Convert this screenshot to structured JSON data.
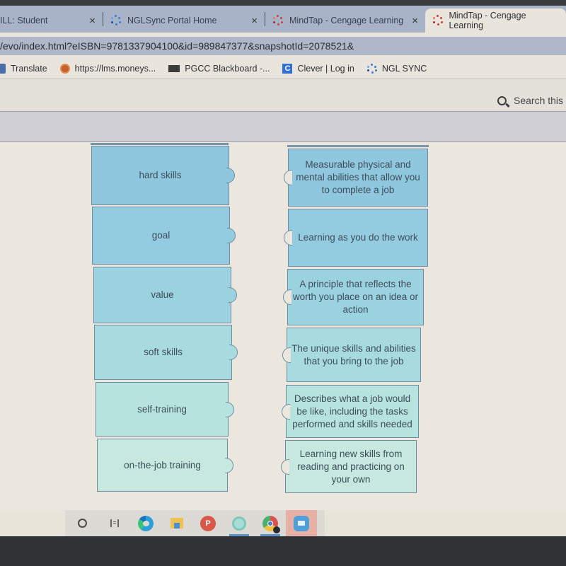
{
  "browser": {
    "tabs": [
      {
        "title": "ILL: Student",
        "icon": "page-icon",
        "active": false
      },
      {
        "title": "NGLSync Portal Home",
        "icon": "ngl-sync-icon",
        "active": false
      },
      {
        "title": "MindTap - Cengage Learning",
        "icon": "mindtap-icon",
        "active": false
      },
      {
        "title": "MindTap - Cengage Learning",
        "icon": "mindtap-icon",
        "active": true
      }
    ],
    "tab_close_glyph": "×",
    "url": "/evo/index.html?eISBN=9781337904100&id=989847377&snapshotId=2078521&",
    "bookmarks": [
      {
        "label": "Translate",
        "icon": "translate-icon"
      },
      {
        "label": "https://lms.moneys...",
        "icon": "moneyskill-icon"
      },
      {
        "label": "PGCC Blackboard -...",
        "icon": "blackboard-icon"
      },
      {
        "label": "Clever | Log in",
        "icon": "clever-icon"
      },
      {
        "label": "NGL SYNC",
        "icon": "ngl-sync-icon"
      }
    ]
  },
  "app": {
    "search_label": "Search this"
  },
  "matching": {
    "terms": [
      {
        "label": "hard skills",
        "color": "#8fc7df"
      },
      {
        "label": "goal",
        "color": "#93cbe0"
      },
      {
        "label": "value",
        "color": "#9ad2df"
      },
      {
        "label": "soft skills",
        "color": "#a8dbe0"
      },
      {
        "label": "self-training",
        "color": "#b7e3df"
      },
      {
        "label": "on-the-job training",
        "color": "#c6e8df"
      }
    ],
    "definitions": [
      {
        "label": "Measurable physical and mental abilities that allow you to complete a job",
        "color": "#8fc7df"
      },
      {
        "label": "Learning as you do the work",
        "color": "#93cbe0"
      },
      {
        "label": "A principle that reflects the worth you place on an idea or action",
        "color": "#9ad2df"
      },
      {
        "label": "The unique skills and abilities that you bring to the job",
        "color": "#a8dbe0"
      },
      {
        "label": "Describes what a job would be like, including the tasks performed and skills needed",
        "color": "#b7e3df"
      },
      {
        "label": "Learning new skills from reading and practicing on your own",
        "color": "#c6e8df"
      }
    ]
  },
  "taskbar": {
    "items": [
      {
        "name": "search-circle-icon"
      },
      {
        "name": "task-view-icon"
      },
      {
        "name": "edge-icon"
      },
      {
        "name": "file-explorer-icon"
      },
      {
        "name": "powerpoint-icon",
        "glyph": "P"
      },
      {
        "name": "internet-explorer-icon"
      },
      {
        "name": "chrome-icon"
      },
      {
        "name": "zoom-icon"
      }
    ]
  }
}
